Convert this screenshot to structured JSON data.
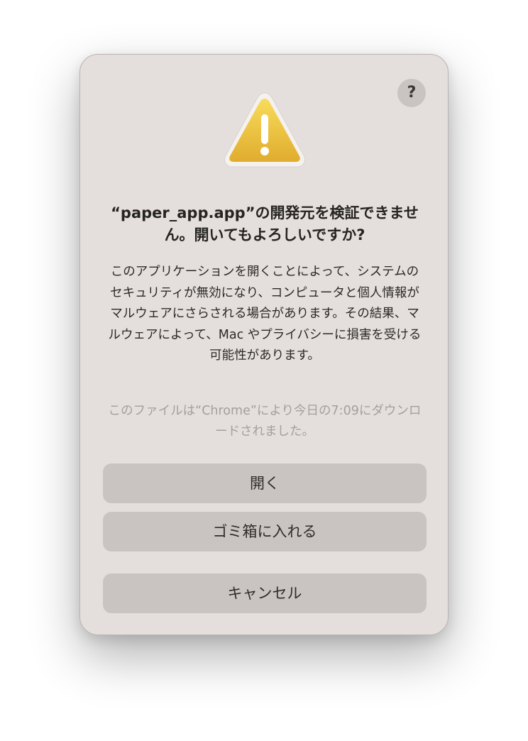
{
  "dialog": {
    "help_label": "?",
    "icon": "warning-triangle-icon",
    "title": "“paper_app.app”の開発元を検証できません。開いてもよろしいですか?",
    "message": "このアプリケーションを開くことによって、システムのセキュリティが無効になり、コンピュータと個人情報がマルウェアにさらされる場合があります。その結果、マルウェアによって、Mac やプライバシーに損害を受ける可能性があります。",
    "source_note": "このファイルは“Chrome”により今日の7:09にダウンロードされました。",
    "buttons": {
      "open": "開く",
      "move_to_trash": "ゴミ箱に入れる",
      "cancel": "キャンセル"
    }
  },
  "colors": {
    "dialog_background": "#e4dfdc",
    "button_background": "#c9c4c1",
    "warning_yellow": "#f0c53c"
  }
}
